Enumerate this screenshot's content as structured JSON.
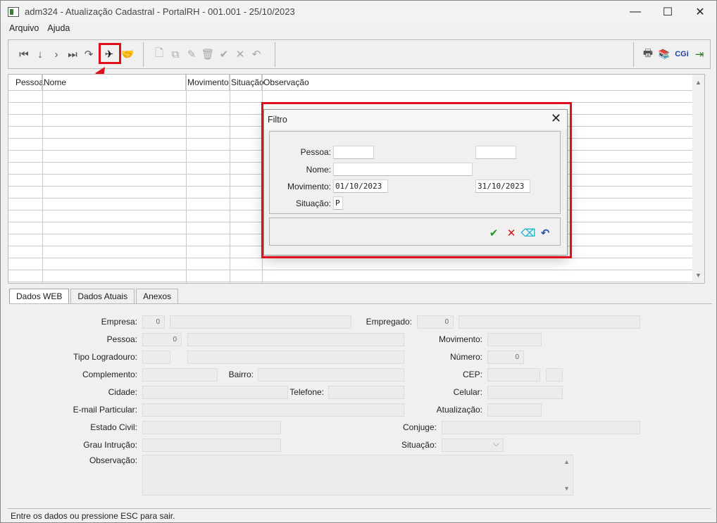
{
  "window": {
    "title": "adm324 - Atualização Cadastral - PortalRH - 001.001 - 25/10/2023"
  },
  "menu": [
    "Arquivo",
    "Ajuda"
  ],
  "toolbar": {
    "nav": [
      {
        "name": "first-record-icon",
        "glyph": "⏮"
      },
      {
        "name": "previous-record-icon",
        "glyph": "↓"
      },
      {
        "name": "next-record-icon",
        "glyph": "›"
      },
      {
        "name": "last-record-icon",
        "glyph": "⏭"
      },
      {
        "name": "refresh-icon",
        "glyph": "↷"
      },
      {
        "name": "filter-send-icon",
        "glyph": "✈"
      },
      {
        "name": "handshake-icon",
        "glyph": "🤝"
      }
    ],
    "edit": [
      {
        "name": "new-document-icon",
        "glyph": "🗋"
      },
      {
        "name": "copy-icon",
        "glyph": "⧉"
      },
      {
        "name": "edit-icon",
        "glyph": "✎"
      },
      {
        "name": "delete-trash-icon",
        "glyph": "🗑"
      },
      {
        "name": "confirm-check-icon",
        "glyph": "✔"
      },
      {
        "name": "cancel-x-icon",
        "glyph": "✕"
      },
      {
        "name": "undo-icon",
        "glyph": "↶"
      }
    ],
    "right": [
      {
        "name": "printer-icon",
        "glyph": "🖶"
      },
      {
        "name": "books-icon",
        "glyph": "📚"
      },
      {
        "name": "cgi-icon",
        "glyph": "CGi"
      },
      {
        "name": "exit-door-icon",
        "glyph": "⇥"
      }
    ]
  },
  "grid": {
    "columns": [
      "Pessoa",
      "Nome",
      "Movimento",
      "Situação",
      "Observação"
    ]
  },
  "tabs": [
    "Dados WEB",
    "Dados Atuais",
    "Anexos"
  ],
  "form": {
    "empresa_label": "Empresa:",
    "empresa_value": "0",
    "empregado_label": "Empregado:",
    "empregado_value": "0",
    "pessoa_label": "Pessoa:",
    "pessoa_value": "0",
    "movimento_label": "Movimento:",
    "tipo_logradouro_label": "Tipo Logradouro:",
    "numero_label": "Número:",
    "numero_value": "0",
    "complemento_label": "Complemento:",
    "bairro_label": "Bairro:",
    "cep_label": "CEP:",
    "cidade_label": "Cidade:",
    "telefone_label": "Telefone:",
    "celular_label": "Celular:",
    "email_label": "E-mail Particular:",
    "atualizacao_label": "Atualização:",
    "estado_civil_label": "Estado Civil:",
    "conjuge_label": "Conjuge:",
    "grau_instrucao_label": "Grau Intrução:",
    "situacao_label": "Situação:",
    "observacao_label": "Observação:"
  },
  "status": "Entre os dados ou pressione ESC para sair.",
  "dialog": {
    "title": "Filtro",
    "pessoa_label": "Pessoa:",
    "nome_label": "Nome:",
    "movimento_label": "Movimento:",
    "movimento_from": "01/10/2023",
    "movimento_to": "31/10/2023",
    "situacao_label": "Situação:",
    "situacao_value": "P",
    "buttons": [
      {
        "name": "ok-check-icon",
        "glyph": "✔"
      },
      {
        "name": "cancel-x-icon",
        "glyph": "✕"
      },
      {
        "name": "clear-eraser-icon",
        "glyph": "⌫"
      },
      {
        "name": "undo-icon",
        "glyph": "↶"
      }
    ]
  },
  "colors": {
    "highlight": "#e0101a",
    "ok": "#1a9a1a",
    "cancel": "#d01010",
    "clear": "#1fb5c9",
    "undo": "#1f4fa8"
  }
}
